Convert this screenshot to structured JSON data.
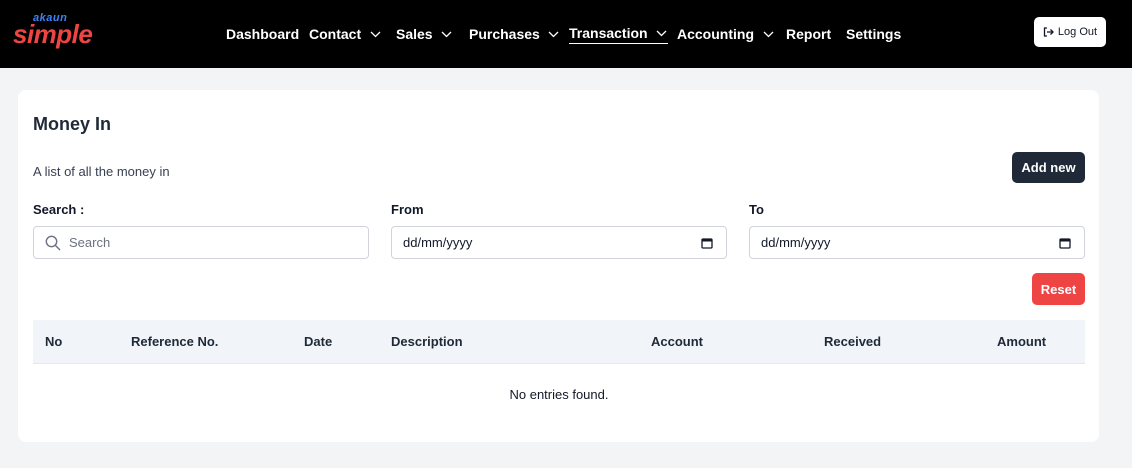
{
  "brand": {
    "small": "akaun",
    "big": "simple"
  },
  "nav": {
    "items": [
      {
        "label": "Dashboard",
        "dropdown": false
      },
      {
        "label": "Contact",
        "dropdown": true
      },
      {
        "label": "Sales",
        "dropdown": true
      },
      {
        "label": "Purchases",
        "dropdown": true
      },
      {
        "label": "Transaction",
        "dropdown": true,
        "active": true
      },
      {
        "label": "Accounting",
        "dropdown": true
      },
      {
        "label": "Report",
        "dropdown": false
      },
      {
        "label": "Settings",
        "dropdown": false
      }
    ],
    "logout_label": "Log Out"
  },
  "page": {
    "title": "Money In",
    "subtitle": "A list of all the money in",
    "add_label": "Add new",
    "reset_label": "Reset"
  },
  "filters": {
    "search_label": "Search :",
    "search_placeholder": "Search",
    "from_label": "From",
    "from_value": "dd/mm/yyyy",
    "to_label": "To",
    "to_value": "dd/mm/yyyy"
  },
  "table": {
    "columns": [
      "No",
      "Reference No.",
      "Date",
      "Description",
      "Account",
      "Received",
      "Amount"
    ],
    "empty_message": "No entries found."
  },
  "colors": {
    "topbar": "#000000",
    "primary_button": "#1f2937",
    "danger_button": "#ef4444",
    "brand_red": "#ef4444",
    "brand_blue": "#3b82f6"
  }
}
